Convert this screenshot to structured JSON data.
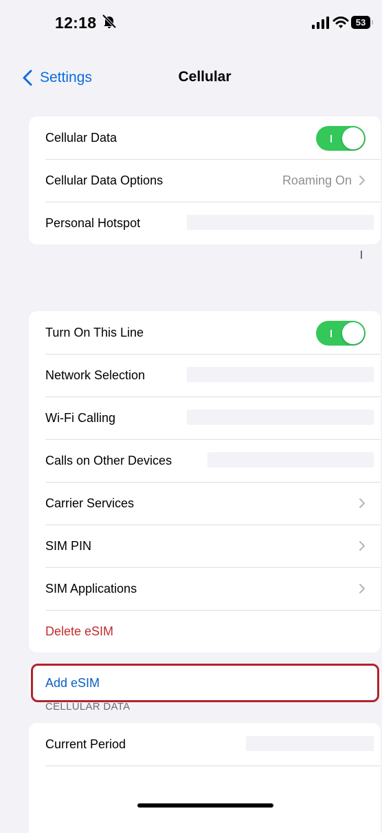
{
  "status_bar": {
    "time": "12:18",
    "battery": "53"
  },
  "nav": {
    "back_label": "Settings",
    "title": "Cellular"
  },
  "group1": {
    "cellular_data": {
      "label": "Cellular Data",
      "toggle_on": true
    },
    "cellular_data_options": {
      "label": "Cellular Data Options",
      "value": "Roaming On"
    },
    "personal_hotspot": {
      "label": "Personal Hotspot"
    }
  },
  "group2": {
    "turn_on_line": {
      "label": "Turn On This Line",
      "toggle_on": true
    },
    "network_selection": {
      "label": "Network Selection"
    },
    "wifi_calling": {
      "label": "Wi-Fi Calling"
    },
    "calls_other_devices": {
      "label": "Calls on Other Devices"
    },
    "carrier_services": {
      "label": "Carrier Services"
    },
    "sim_pin": {
      "label": "SIM PIN"
    },
    "sim_applications": {
      "label": "SIM Applications"
    },
    "delete_esim": {
      "label": "Delete eSIM"
    }
  },
  "add_esim": {
    "label": "Add eSIM"
  },
  "cellular_data_section": {
    "header": "CELLULAR DATA",
    "current_period": {
      "label": "Current Period"
    }
  },
  "colors": {
    "accent": "#0a6ce0",
    "toggle_on": "#34c759",
    "destructive": "#c52b2b",
    "highlight_box": "#b0232a"
  },
  "icons": [
    "silent-bell-icon",
    "signal-icon",
    "wifi-icon",
    "battery-icon",
    "back-chevron-icon",
    "chevron-right-icon"
  ]
}
